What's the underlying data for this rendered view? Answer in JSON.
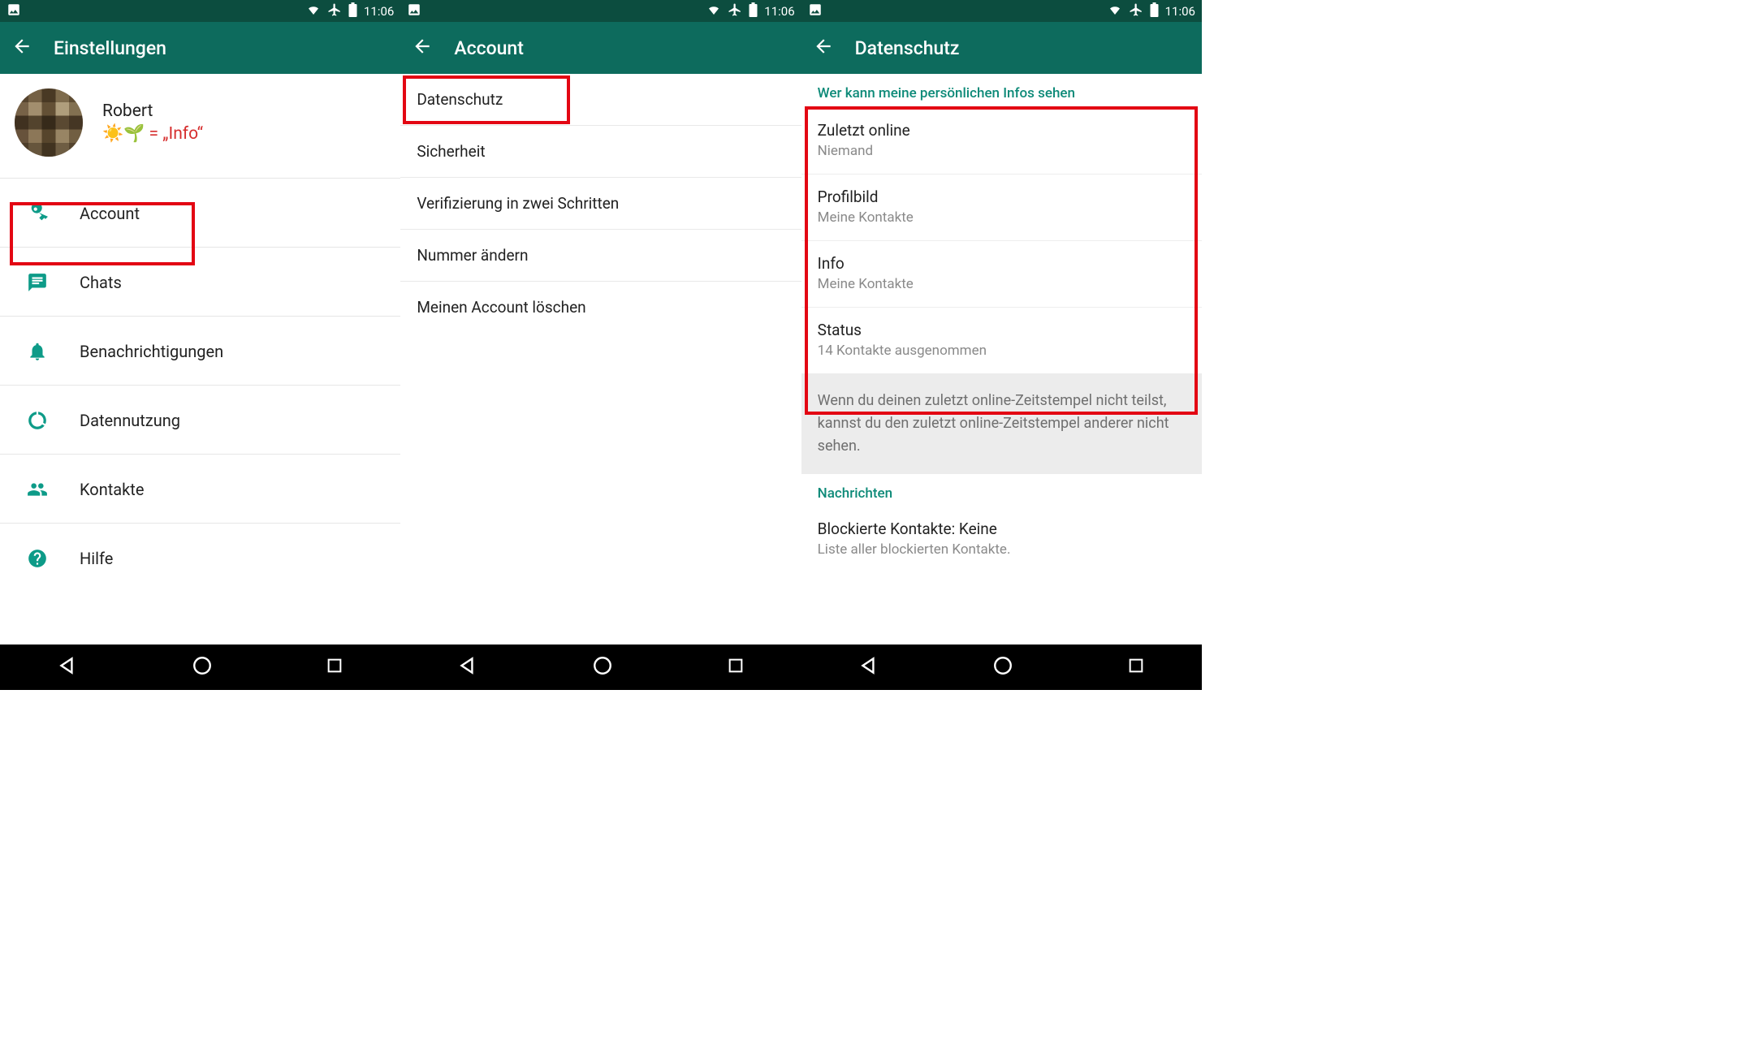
{
  "statusbar": {
    "time": "11:06"
  },
  "screen1": {
    "title": "Einstellungen",
    "profile": {
      "name": "Robert",
      "status": "☀️🌱 = „Info“"
    },
    "items": [
      {
        "icon": "key",
        "label": "Account"
      },
      {
        "icon": "chat",
        "label": "Chats"
      },
      {
        "icon": "bell",
        "label": "Benachrichtigungen"
      },
      {
        "icon": "circle-data",
        "label": "Datennutzung"
      },
      {
        "icon": "contacts",
        "label": "Kontakte"
      },
      {
        "icon": "help",
        "label": "Hilfe"
      }
    ]
  },
  "screen2": {
    "title": "Account",
    "items": [
      {
        "label": "Datenschutz"
      },
      {
        "label": "Sicherheit"
      },
      {
        "label": "Verifizierung in zwei Schritten"
      },
      {
        "label": "Nummer ändern"
      },
      {
        "label": "Meinen Account löschen"
      }
    ]
  },
  "screen3": {
    "title": "Datenschutz",
    "section1_header": "Wer kann meine persönlichen Infos sehen",
    "privacy": [
      {
        "title": "Zuletzt online",
        "value": "Niemand"
      },
      {
        "title": "Profilbild",
        "value": "Meine Kontakte"
      },
      {
        "title": "Info",
        "value": "Meine Kontakte"
      },
      {
        "title": "Status",
        "value": "14 Kontakte ausgenommen"
      }
    ],
    "info_text": "Wenn du deinen zuletzt online-Zeitstempel nicht teilst, kannst du den zuletzt online-Zeitstempel anderer nicht sehen.",
    "section2_header": "Nachrichten",
    "blocked": {
      "title": "Blockierte Kontakte: Keine",
      "subtitle": "Liste aller blockierten Kontakte."
    }
  }
}
